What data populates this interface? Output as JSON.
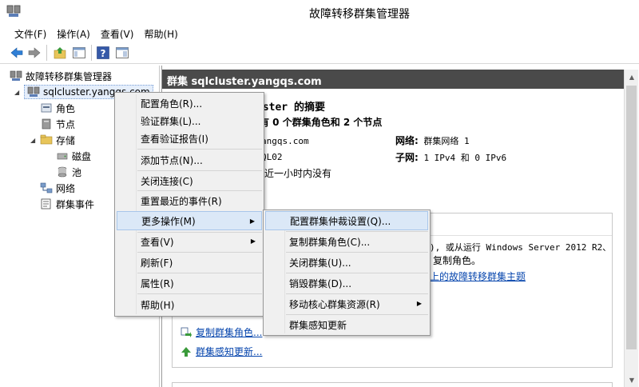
{
  "window": {
    "title": "故障转移群集管理器"
  },
  "menubar": [
    "文件(F)",
    "操作(A)",
    "查看(V)",
    "帮助(H)"
  ],
  "toolbar": {
    "icons": [
      "back-arrow-icon",
      "forward-arrow-icon",
      "up-folder-icon",
      "console-tree-icon",
      "help-icon",
      "action-pane-icon"
    ]
  },
  "tree": {
    "root": "故障转移群集管理器",
    "cluster": "sqlcluster.yangqs.com",
    "roles": "角色",
    "nodes": "节点",
    "storage": "存储",
    "disks": "磁盘",
    "pools": "池",
    "networks": "网络",
    "events": "群集事件"
  },
  "right": {
    "header": "群集 sqlcluster.yangqs.com",
    "summary_title": "uster 的摘要",
    "summary_sub": "拥有 0 个群集角色和 2 个节点",
    "domain_partial": "angqs.com",
    "network_label": "网络:",
    "network_value": "群集网络 1",
    "witness_partial": "QL02",
    "subnet_label": "子网:",
    "subnet_value": "1 IPv4 和 0 IPv6",
    "events_partial": "近一小时内没有",
    "group_line1": "), 或从运行 Windows Server 2012 R2、",
    "group_line2": "复制角色。",
    "group_link": "上的故障转移群集主题",
    "action_copy": "复制群集角色...",
    "action_cau": "群集感知更新..."
  },
  "context_menu": {
    "items": [
      "配置角色(R)...",
      "验证群集(L)...",
      "查看验证报告(I)",
      "添加节点(N)...",
      "关闭连接(C)",
      "重置最近的事件(R)",
      "更多操作(M)",
      "查看(V)",
      "刷新(F)",
      "属性(R)",
      "帮助(H)"
    ]
  },
  "submenu": {
    "items": [
      "配置群集仲裁设置(Q)...",
      "复制群集角色(C)...",
      "关闭群集(U)...",
      "销毁群集(D)...",
      "移动核心群集资源(R)",
      "群集感知更新"
    ]
  },
  "colors": {
    "header_bg": "#4a4a4a",
    "highlight": "#dbe8f7",
    "link": "#0645ad"
  }
}
